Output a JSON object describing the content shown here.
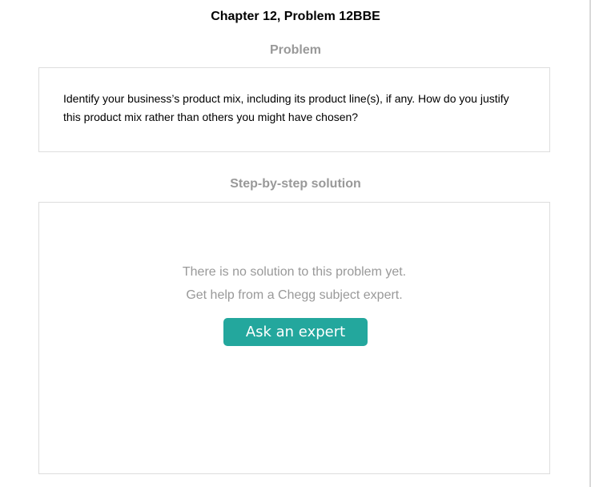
{
  "page": {
    "title": "Chapter 12, Problem 12BBE"
  },
  "problem": {
    "heading": "Problem",
    "text": "Identify your business’s product mix, including its product line(s), if any. How do you justify this product mix rather than others you might have chosen?"
  },
  "solution": {
    "heading": "Step-by-step solution",
    "empty_message_line1": "There is no solution to this problem yet.",
    "empty_message_line2": "Get help from a Chegg subject expert.",
    "ask_button_label": "Ask an expert"
  },
  "colors": {
    "accent": "#23a79d",
    "muted_text": "#999999",
    "border": "#dddddd"
  }
}
